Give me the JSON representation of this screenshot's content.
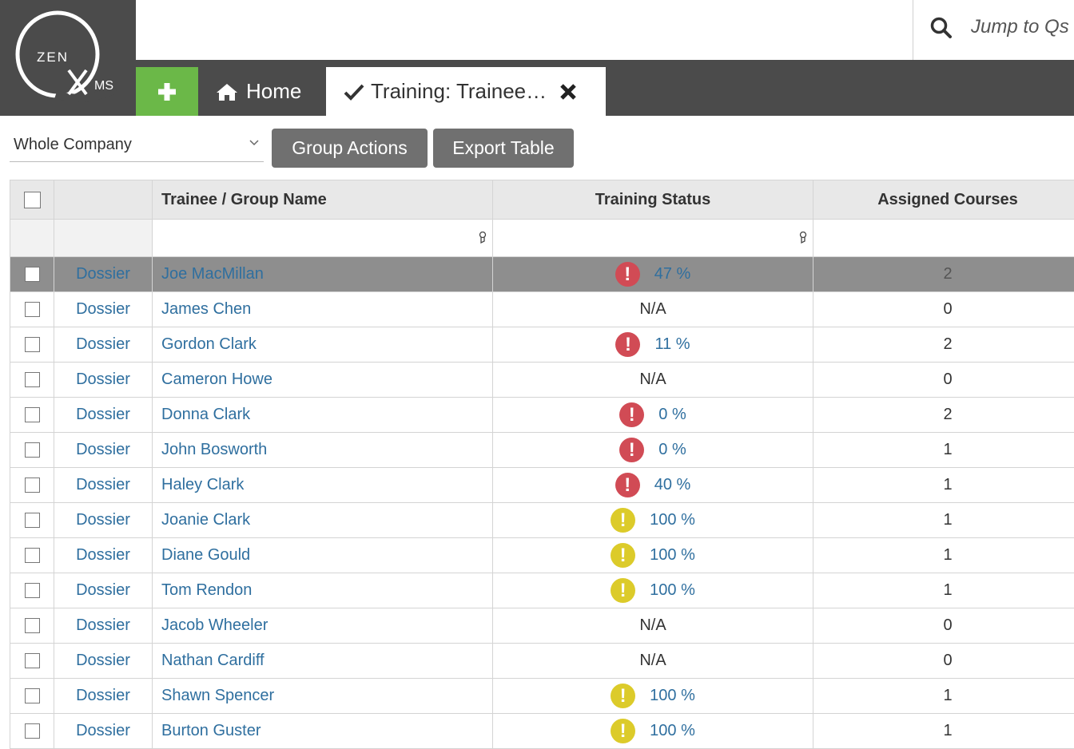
{
  "app": {
    "logo_text": "ZEN QMS",
    "logo_left": "ZEN",
    "logo_right": "MS",
    "search_placeholder": "Jump to Qs"
  },
  "tabs": {
    "add_icon": "plus-icon",
    "home_label": "Home",
    "active_label": "Training: Trainee…"
  },
  "toolbar": {
    "scope_value": "Whole Company",
    "group_actions_label": "Group Actions",
    "export_label": "Export Table"
  },
  "table": {
    "headers": {
      "name": "Trainee / Group Name",
      "status": "Training Status",
      "courses": "Assigned Courses"
    },
    "status_colors": {
      "red": "#d14b55",
      "yellow": "#dccb2a"
    },
    "rows": [
      {
        "dossier": "Dossier",
        "name": "Joe MacMillan",
        "status": "47 %",
        "status_icon": "red",
        "courses": "2"
      },
      {
        "dossier": "Dossier",
        "name": "James Chen",
        "status": "N/A",
        "status_icon": "",
        "courses": "0"
      },
      {
        "dossier": "Dossier",
        "name": "Gordon Clark",
        "status": "11 %",
        "status_icon": "red",
        "courses": "2"
      },
      {
        "dossier": "Dossier",
        "name": "Cameron Howe",
        "status": "N/A",
        "status_icon": "",
        "courses": "0"
      },
      {
        "dossier": "Dossier",
        "name": "Donna Clark",
        "status": "0 %",
        "status_icon": "red",
        "courses": "2"
      },
      {
        "dossier": "Dossier",
        "name": "John Bosworth",
        "status": "0 %",
        "status_icon": "red",
        "courses": "1"
      },
      {
        "dossier": "Dossier",
        "name": "Haley Clark",
        "status": "40 %",
        "status_icon": "red",
        "courses": "1"
      },
      {
        "dossier": "Dossier",
        "name": "Joanie Clark",
        "status": "100 %",
        "status_icon": "yellow",
        "courses": "1"
      },
      {
        "dossier": "Dossier",
        "name": "Diane Gould",
        "status": "100 %",
        "status_icon": "yellow",
        "courses": "1"
      },
      {
        "dossier": "Dossier",
        "name": "Tom Rendon",
        "status": "100 %",
        "status_icon": "yellow",
        "courses": "1"
      },
      {
        "dossier": "Dossier",
        "name": "Jacob Wheeler",
        "status": "N/A",
        "status_icon": "",
        "courses": "0"
      },
      {
        "dossier": "Dossier",
        "name": "Nathan Cardiff",
        "status": "N/A",
        "status_icon": "",
        "courses": "0"
      },
      {
        "dossier": "Dossier",
        "name": "Shawn Spencer",
        "status": "100 %",
        "status_icon": "yellow",
        "courses": "1"
      },
      {
        "dossier": "Dossier",
        "name": "Burton Guster",
        "status": "100 %",
        "status_icon": "yellow",
        "courses": "1"
      }
    ]
  }
}
